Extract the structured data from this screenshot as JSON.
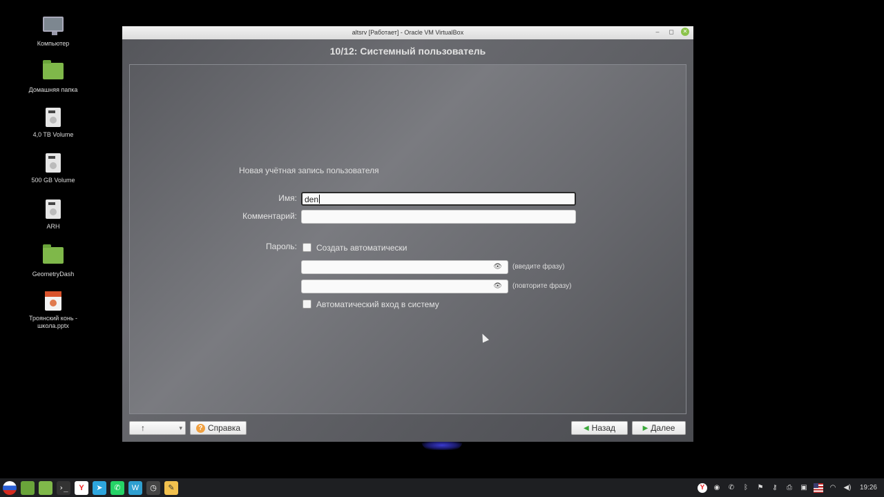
{
  "desktop": {
    "icons": [
      {
        "label": "Компьютер",
        "icon": "computer-icon"
      },
      {
        "label": "Домашняя папка",
        "icon": "home-folder-icon"
      },
      {
        "label": "4,0 TB Volume",
        "icon": "drive-icon"
      },
      {
        "label": "500 GB Volume",
        "icon": "drive-icon"
      },
      {
        "label": "ARH",
        "icon": "drive-icon"
      },
      {
        "label": "GeometryDash",
        "icon": "folder-icon"
      },
      {
        "label": "Троянский конь - школа.pptx",
        "icon": "pptx-file-icon"
      }
    ]
  },
  "window": {
    "title": "altsrv [Работает] - Oracle VM VirtualBox",
    "minimize": "–",
    "maximize": "◻",
    "close": "✕"
  },
  "installer": {
    "step_title": "10/12: Системный пользователь",
    "section_title": "Новая учётная запись пользователя",
    "name_label": "Имя:",
    "name_value": "den",
    "comment_label": "Комментарий:",
    "comment_value": "",
    "password_label": "Пароль:",
    "auto_generate_label": "Создать автоматически",
    "auto_generate_checked": false,
    "password_hint": "(введите фразу)",
    "repeat_hint": "(повторите фразу)",
    "auto_login_label": "Автоматический вход в систему",
    "auto_login_checked": false,
    "buttons": {
      "up": "↑",
      "dropdown": "▾",
      "help": "Справка",
      "back": "Назад",
      "next": "Далее"
    }
  },
  "taskbar": {
    "clock": "19:26",
    "apps": [
      "flag-ru-icon",
      "file-manager-icon",
      "folder-icon",
      "terminal-icon",
      "yandex-browser-icon",
      "telegram-icon",
      "whatsapp-icon",
      "virtualbox-icon",
      "clock-icon",
      "notes-icon"
    ],
    "tray": [
      "yandex-icon",
      "obs-icon",
      "whatsapp-icon",
      "bluetooth-icon",
      "flag-icon",
      "key-icon",
      "printer-icon",
      "battery-icon",
      "flag-us-icon",
      "wifi-icon",
      "volume-icon"
    ]
  },
  "colors": {
    "accent_green": "#8bc34a",
    "help_orange": "#f0a040"
  }
}
